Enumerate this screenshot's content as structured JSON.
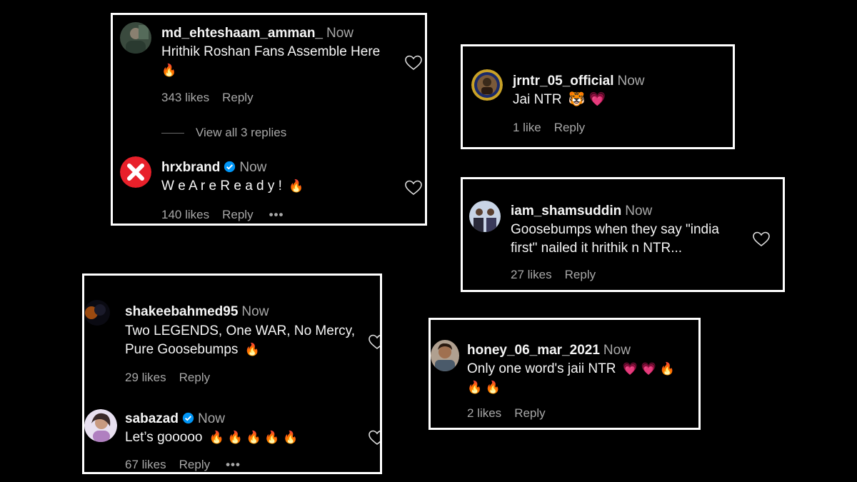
{
  "cards": [
    {
      "comments": [
        {
          "username": "md_ehteshaam_amman_",
          "time": "Now",
          "text": "Hrithik Roshan Fans Assemble Here",
          "emoji_line": "🔥",
          "likes": "343 likes",
          "reply": "Reply",
          "view_replies": "View all 3 replies"
        },
        {
          "username": "hrxbrand",
          "time": "Now",
          "text": "W e A r e R e a d y !",
          "emoji": "🔥",
          "likes": "140 likes",
          "reply": "Reply",
          "more": "•••"
        }
      ]
    },
    {
      "comments": [
        {
          "username": "jrntr_05_official",
          "time": "Now",
          "text": "Jai NTR",
          "emoji": "🐯 💗",
          "likes": "1 like",
          "reply": "Reply"
        }
      ]
    },
    {
      "comments": [
        {
          "username": "iam_shamsuddin",
          "time": "Now",
          "text_line1": "Goosebumps when they say \"india",
          "text_line2": "first\" nailed it hrithik n NTR...",
          "likes": "27 likes",
          "reply": "Reply"
        }
      ]
    },
    {
      "comments": [
        {
          "username": "shakeebahmed95",
          "time": "Now",
          "text_line1": "Two LEGENDS, One WAR, No Mercy,",
          "text_line2": "Pure Goosebumps",
          "emoji": "🔥",
          "likes": "29 likes",
          "reply": "Reply"
        },
        {
          "username": "sabazad",
          "time": "Now",
          "text": "Let’s gooooo",
          "emoji": "🔥 🔥 🔥 🔥 🔥",
          "likes": "67 likes",
          "reply": "Reply",
          "more": "•••"
        }
      ]
    },
    {
      "comments": [
        {
          "username": "honey_06_mar_2021",
          "time": "Now",
          "text": "Only one word's jaii NTR",
          "emoji": "💗 💗 🔥",
          "emoji_line": "🔥 🔥",
          "likes": "2 likes",
          "reply": "Reply"
        }
      ]
    }
  ],
  "colors": {
    "background": "#000000",
    "border": "#ffffff",
    "muted": "#a8a8a8",
    "verified": "#0095f6",
    "brand_red": "#e8202a"
  }
}
